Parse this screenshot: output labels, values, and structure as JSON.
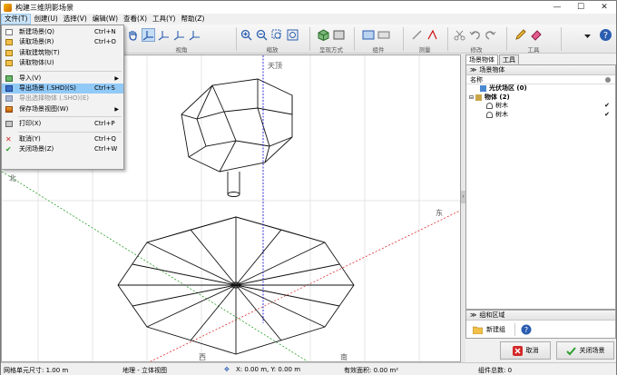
{
  "window": {
    "title": "构建三维阴影场景",
    "minimize": "—",
    "maximize": "☐",
    "close": "✕"
  },
  "menu": [
    "文件(T)",
    "创建(U)",
    "选择(V)",
    "编辑(W)",
    "查看(X)",
    "工具(Y)",
    "帮助(Z)"
  ],
  "file_menu": {
    "items": [
      {
        "label": "新建场景(Q)",
        "shortcut": "Ctrl+N",
        "icon": "new-scene-icon"
      },
      {
        "label": "读取场景(R)",
        "shortcut": "Ctrl+O",
        "icon": "folder-open-icon"
      },
      {
        "label": "读取建筑物(T)",
        "shortcut": "",
        "icon": "folder-open-icon"
      },
      {
        "label": "读取物体(U)",
        "shortcut": "",
        "icon": "folder-open-icon"
      },
      {
        "label": "导入(V)",
        "shortcut": "",
        "icon": "import-icon",
        "submenu": true
      },
      {
        "label": "导出场景 (.SHD)(S)",
        "shortcut": "Ctrl+S",
        "icon": "save-icon",
        "highlighted": true
      },
      {
        "label": "导出选择物体 (.SHO)(E)",
        "shortcut": "",
        "icon": "save-icon",
        "disabled": true
      },
      {
        "label": "保存场景视图(W)",
        "shortcut": "",
        "icon": "save-view-icon",
        "submenu": true
      },
      {
        "label": "打印(X)",
        "shortcut": "Ctrl+P",
        "icon": "printer-icon"
      },
      {
        "label": "取消(Y)",
        "shortcut": "Ctrl+Q",
        "icon": "cancel-icon"
      },
      {
        "label": "关闭场景(Z)",
        "shortcut": "Ctrl+W",
        "icon": "check-icon"
      }
    ]
  },
  "toolbar": {
    "groups": [
      {
        "label": "视角"
      },
      {
        "label": "缩放"
      },
      {
        "label": "呈现方式"
      },
      {
        "label": "组件"
      },
      {
        "label": "测量"
      },
      {
        "label": "修改"
      },
      {
        "label": "工具"
      }
    ]
  },
  "viewport": {
    "label_top": "天顶",
    "label_north": "北",
    "label_east": "东",
    "label_west": "西",
    "label_south": "南"
  },
  "right_panel": {
    "tabs": [
      "场景物体",
      "工具"
    ],
    "scene_header": "场景物体",
    "column_name": "名称",
    "tree": [
      {
        "label": "光伏场区 (0)",
        "bold": true,
        "level": 0
      },
      {
        "label": "物体 (2)",
        "bold": true,
        "level": 0
      },
      {
        "label": "树木",
        "level": 1,
        "checked": "✔"
      },
      {
        "label": "树木",
        "level": 1,
        "checked": "✔"
      }
    ],
    "group_header": "组和区域",
    "new_group": "新建组",
    "help": "?"
  },
  "buttons": {
    "cancel": "取消",
    "close_scene": "关闭场景"
  },
  "status": {
    "grid_unit": "网格单元尺寸: 1.00 m",
    "view_mode": "地理 - 立体视图",
    "coords": "X: 0.00 m, Y: 0.00 m",
    "shadow_area": "有效面积: 0.00 m²",
    "component_count": "组件总数: 0"
  }
}
